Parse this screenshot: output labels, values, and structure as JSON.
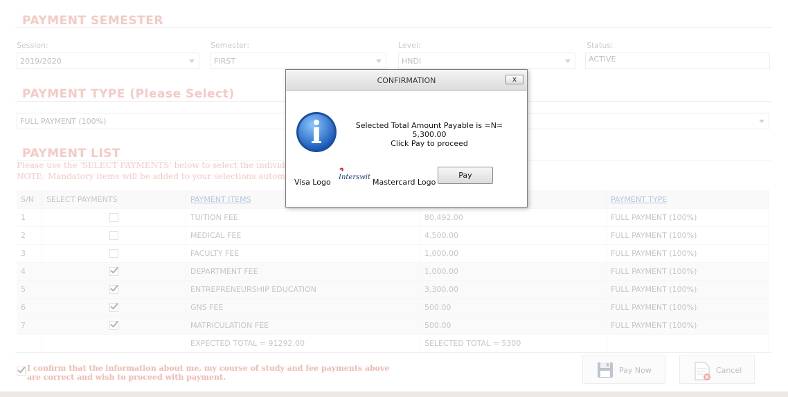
{
  "semester_section": {
    "title": "PAYMENT SEMESTER",
    "session_label": "Session:",
    "session_value": "2019/2020",
    "semester_label": "Semester:",
    "semester_value": "FIRST",
    "level_label": "Level:",
    "level_value": "HNDI",
    "status_label": "Status:",
    "status_value": "ACTIVE"
  },
  "type_section": {
    "title": "PAYMENT TYPE (Please Select)",
    "payment_type_value": "FULL PAYMENT (100%)"
  },
  "list_section": {
    "title": "PAYMENT LIST",
    "note1": "Please use the 'SELECT PAYMENTS' below to select the individual pay",
    "note2": "NOTE: Mandatory items will be added to your selections automatically.",
    "headers": {
      "sn": "S/N",
      "select": "SELECT PAYMENTS",
      "items": "PAYMENT ITEMS",
      "type": "PAYMENT TYPE"
    },
    "rows": [
      {
        "sn": "1",
        "checked": false,
        "item": "TUITION FEE",
        "amount": "80,492.00",
        "type": "FULL PAYMENT (100%)"
      },
      {
        "sn": "2",
        "checked": false,
        "item": "MEDICAL FEE",
        "amount": "4,500.00",
        "type": "FULL PAYMENT (100%)"
      },
      {
        "sn": "3",
        "checked": false,
        "item": "FACULTY FEE",
        "amount": "1,000.00",
        "type": "FULL PAYMENT (100%)"
      },
      {
        "sn": "4",
        "checked": true,
        "item": "DEPARTMENT FEE",
        "amount": "1,000.00",
        "type": "FULL PAYMENT (100%)"
      },
      {
        "sn": "5",
        "checked": true,
        "item": "ENTREPRENEURSHIP EDUCATION",
        "amount": "3,300.00",
        "type": "FULL PAYMENT (100%)"
      },
      {
        "sn": "6",
        "checked": true,
        "item": "GNS FEE",
        "amount": "500.00",
        "type": "FULL PAYMENT (100%)"
      },
      {
        "sn": "7",
        "checked": true,
        "item": "MATRICULATION FEE",
        "amount": "500.00",
        "type": "FULL PAYMENT (100%)"
      }
    ],
    "expected_total": "EXPECTED TOTAL = 91292.00",
    "selected_total": "SELECTED TOTAL = 5300"
  },
  "footer": {
    "confirm_text": "I confirm that the information about me, my course of study and fee payments above are correct and wish to proceed with payment.",
    "confirm_checked": true,
    "pay_now_label": "Pay Now",
    "cancel_label": "Cancel"
  },
  "dialog": {
    "title": "CONFIRMATION",
    "close_label": "x",
    "message_line1": "Selected Total Amount Payable is =N=",
    "message_line2": "5,300.00",
    "message_line3": "Click Pay to proceed",
    "visa_logo_alt": "Visa Logo",
    "interswitch_logo": "Interswitch",
    "mastercard_logo_alt": "Mastercard Logo",
    "pay_label": "Pay"
  },
  "colors": {
    "section_title": "#e98a7c",
    "link_header": "#5a7fb6",
    "confirm_text": "#e1614f"
  }
}
